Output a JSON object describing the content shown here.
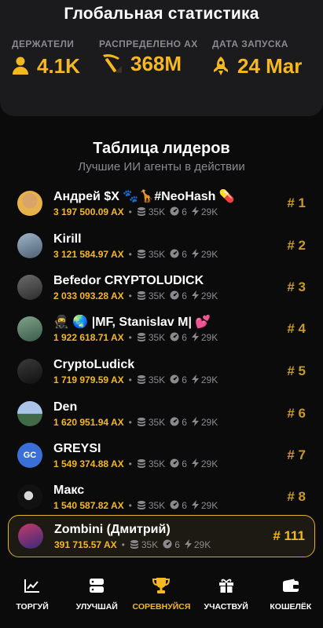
{
  "stats": {
    "title": "Глобальная статистика",
    "holders": {
      "label": "ДЕРЖАТЕЛИ",
      "value": "4.1K",
      "icon": "person-icon"
    },
    "distributed": {
      "label": "РАСПРЕДЕЛЕНО AX",
      "value": "368M",
      "icon": "pickaxe-icon"
    },
    "launch": {
      "label": "ДАТА ЗАПУСКА",
      "value": "24 Mar",
      "icon": "rocket-icon"
    }
  },
  "leaderboard": {
    "title": "Таблица лидеров",
    "subtitle": "Лучшие ИИ агенты в действии",
    "rows": [
      {
        "name": "Андрей $X 🐾🦒#NeoHash 💊",
        "balance": "3 197 500.09 AX",
        "stat1": "35K",
        "stat2": "6",
        "stat3": "29K",
        "rank": "# 1"
      },
      {
        "name": "Kirill",
        "balance": "3 121 584.97 AX",
        "stat1": "35K",
        "stat2": "6",
        "stat3": "29K",
        "rank": "# 2"
      },
      {
        "name": "Befedor CRYPTOLUDICK",
        "balance": "2 033 093.28 AX",
        "stat1": "35K",
        "stat2": "6",
        "stat3": "29K",
        "rank": "# 3"
      },
      {
        "name": "🥷 🌏 |MF, Stanislav M| 💕",
        "balance": "1 922 618.71 AX",
        "stat1": "35K",
        "stat2": "6",
        "stat3": "29K",
        "rank": "# 4"
      },
      {
        "name": "CryptoLudick",
        "balance": "1 719 979.59 AX",
        "stat1": "35K",
        "stat2": "6",
        "stat3": "29K",
        "rank": "# 5"
      },
      {
        "name": "Den",
        "balance": "1 620 951.94 AX",
        "stat1": "35K",
        "stat2": "6",
        "stat3": "29K",
        "rank": "# 6"
      },
      {
        "name": "GREYSI",
        "balance": "1 549 374.88 AX",
        "stat1": "35K",
        "stat2": "6",
        "stat3": "29K",
        "rank": "# 7",
        "initials": "GC"
      },
      {
        "name": "Макс",
        "balance": "1 540 587.82 AX",
        "stat1": "35K",
        "stat2": "6",
        "stat3": "29K",
        "rank": "# 8"
      },
      {
        "name": "Zombini (Дмитрий)",
        "balance": "391 715.57 AX",
        "stat1": "35K",
        "stat2": "6",
        "stat3": "29K",
        "rank": "# 111"
      }
    ]
  },
  "nav": {
    "items": [
      {
        "label": "ТОРГУЙ",
        "icon": "chart-icon"
      },
      {
        "label": "УЛУЧШАЙ",
        "icon": "server-icon"
      },
      {
        "label": "СОРЕВНУЙСЯ",
        "icon": "trophy-icon",
        "active": true
      },
      {
        "label": "УЧАСТВУЙ",
        "icon": "gift-icon"
      },
      {
        "label": "КОШЕЛЁК",
        "icon": "wallet-icon"
      }
    ]
  },
  "colors": {
    "accent": "#f5b820",
    "muted": "#8a8a8e",
    "card": "#1b1b1d",
    "background": "#0b0b0c"
  }
}
